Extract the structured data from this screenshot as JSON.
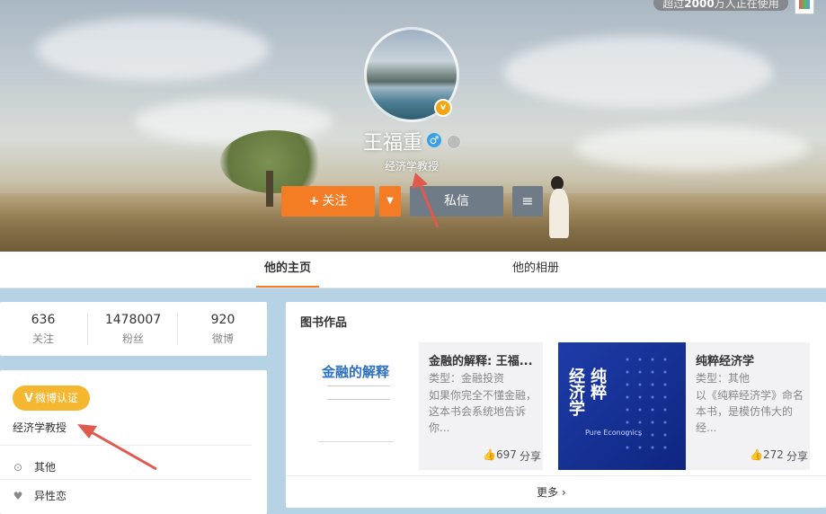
{
  "banner": {
    "top_badge_prefix": "超过",
    "top_badge_number": "2000",
    "top_badge_suffix": "万人正在使用",
    "name": "王福重",
    "subtitle": "经济学教授",
    "avatar_badge": "v",
    "gender_symbol": "♂",
    "follow_plus": "+",
    "follow_label": "关注",
    "dropdown_symbol": "▼",
    "message_label": "私信",
    "menu_symbol": "≡"
  },
  "tabs": [
    {
      "label": "他的主页"
    },
    {
      "label": "他的相册"
    }
  ],
  "stats": [
    {
      "value": "636",
      "label": "关注"
    },
    {
      "value": "1478007",
      "label": "粉丝"
    },
    {
      "value": "920",
      "label": "微博"
    }
  ],
  "profile": {
    "verify_mark": "V",
    "verify_label": "微博认证",
    "verify_text": "经济学教授",
    "location_icon": "⊙",
    "location": "其他",
    "heart_icon": "♥",
    "orientation": "异性恋"
  },
  "books": {
    "title": "图书作品",
    "items": [
      {
        "title": "金融的解释: 王福...",
        "type": "类型：金融投资",
        "desc": "如果你完全不懂金融，这本书会系统地告诉你...",
        "cover_title": "金融的解释",
        "likes": "697",
        "share": "分享"
      },
      {
        "title": "纯粹经济学",
        "type": "类型：其他",
        "desc": "以《纯粹经济学》命名本书，是模仿伟大的经...",
        "cover_title_1": "纯粹",
        "cover_title_2": "经济学",
        "cover_sub": "Pure Economics",
        "likes": "272",
        "share": "分享"
      }
    ],
    "more": "更多 ›"
  },
  "colors": {
    "accent_orange": "#f37c24",
    "gray_button": "#6f7b86",
    "verify_gold": "#f5b630",
    "page_background": "#b6d3e6",
    "annotation_arrow": "#e05a4e"
  }
}
